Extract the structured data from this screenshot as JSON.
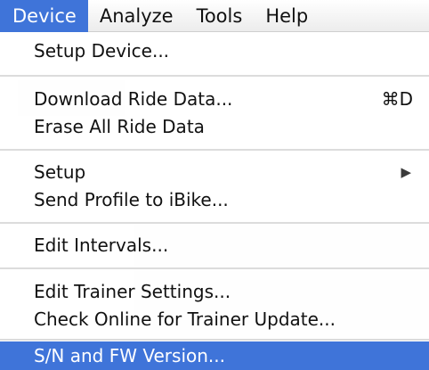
{
  "menubar": {
    "items": [
      {
        "label": "Device",
        "active": true
      },
      {
        "label": "Analyze",
        "active": false
      },
      {
        "label": "Tools",
        "active": false
      },
      {
        "label": "Help",
        "active": false
      }
    ]
  },
  "dropdown": {
    "setup_device": "Setup Device...",
    "download_ride_data": "Download Ride Data...",
    "download_shortcut": "⌘D",
    "erase_ride_data": "Erase All Ride Data",
    "setup": "Setup",
    "setup_submenu_arrow": "▶",
    "send_profile": "Send Profile to iBike...",
    "edit_intervals": "Edit Intervals...",
    "edit_trainer_settings": "Edit Trainer Settings...",
    "check_trainer_update": "Check Online for Trainer Update...",
    "sn_fw_version": "S/N and FW Version...",
    "highlight_color": "#3f74d9"
  }
}
